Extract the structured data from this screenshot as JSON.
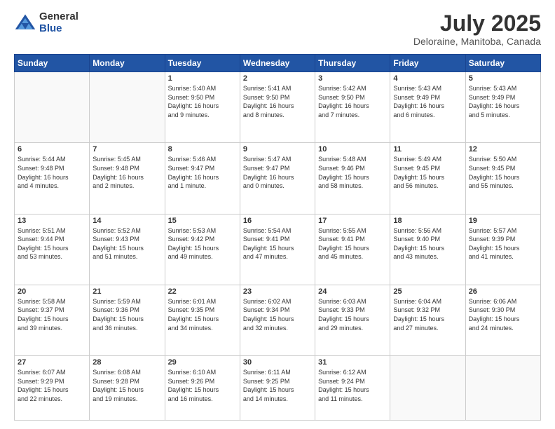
{
  "header": {
    "logo_general": "General",
    "logo_blue": "Blue",
    "month_title": "July 2025",
    "location": "Deloraine, Manitoba, Canada"
  },
  "days_of_week": [
    "Sunday",
    "Monday",
    "Tuesday",
    "Wednesday",
    "Thursday",
    "Friday",
    "Saturday"
  ],
  "weeks": [
    [
      {
        "day": "",
        "info": "",
        "empty": true
      },
      {
        "day": "",
        "info": "",
        "empty": true
      },
      {
        "day": "1",
        "info": "Sunrise: 5:40 AM\nSunset: 9:50 PM\nDaylight: 16 hours\nand 9 minutes."
      },
      {
        "day": "2",
        "info": "Sunrise: 5:41 AM\nSunset: 9:50 PM\nDaylight: 16 hours\nand 8 minutes."
      },
      {
        "day": "3",
        "info": "Sunrise: 5:42 AM\nSunset: 9:50 PM\nDaylight: 16 hours\nand 7 minutes."
      },
      {
        "day": "4",
        "info": "Sunrise: 5:43 AM\nSunset: 9:49 PM\nDaylight: 16 hours\nand 6 minutes."
      },
      {
        "day": "5",
        "info": "Sunrise: 5:43 AM\nSunset: 9:49 PM\nDaylight: 16 hours\nand 5 minutes."
      }
    ],
    [
      {
        "day": "6",
        "info": "Sunrise: 5:44 AM\nSunset: 9:48 PM\nDaylight: 16 hours\nand 4 minutes."
      },
      {
        "day": "7",
        "info": "Sunrise: 5:45 AM\nSunset: 9:48 PM\nDaylight: 16 hours\nand 2 minutes."
      },
      {
        "day": "8",
        "info": "Sunrise: 5:46 AM\nSunset: 9:47 PM\nDaylight: 16 hours\nand 1 minute."
      },
      {
        "day": "9",
        "info": "Sunrise: 5:47 AM\nSunset: 9:47 PM\nDaylight: 16 hours\nand 0 minutes."
      },
      {
        "day": "10",
        "info": "Sunrise: 5:48 AM\nSunset: 9:46 PM\nDaylight: 15 hours\nand 58 minutes."
      },
      {
        "day": "11",
        "info": "Sunrise: 5:49 AM\nSunset: 9:45 PM\nDaylight: 15 hours\nand 56 minutes."
      },
      {
        "day": "12",
        "info": "Sunrise: 5:50 AM\nSunset: 9:45 PM\nDaylight: 15 hours\nand 55 minutes."
      }
    ],
    [
      {
        "day": "13",
        "info": "Sunrise: 5:51 AM\nSunset: 9:44 PM\nDaylight: 15 hours\nand 53 minutes."
      },
      {
        "day": "14",
        "info": "Sunrise: 5:52 AM\nSunset: 9:43 PM\nDaylight: 15 hours\nand 51 minutes."
      },
      {
        "day": "15",
        "info": "Sunrise: 5:53 AM\nSunset: 9:42 PM\nDaylight: 15 hours\nand 49 minutes."
      },
      {
        "day": "16",
        "info": "Sunrise: 5:54 AM\nSunset: 9:41 PM\nDaylight: 15 hours\nand 47 minutes."
      },
      {
        "day": "17",
        "info": "Sunrise: 5:55 AM\nSunset: 9:41 PM\nDaylight: 15 hours\nand 45 minutes."
      },
      {
        "day": "18",
        "info": "Sunrise: 5:56 AM\nSunset: 9:40 PM\nDaylight: 15 hours\nand 43 minutes."
      },
      {
        "day": "19",
        "info": "Sunrise: 5:57 AM\nSunset: 9:39 PM\nDaylight: 15 hours\nand 41 minutes."
      }
    ],
    [
      {
        "day": "20",
        "info": "Sunrise: 5:58 AM\nSunset: 9:37 PM\nDaylight: 15 hours\nand 39 minutes."
      },
      {
        "day": "21",
        "info": "Sunrise: 5:59 AM\nSunset: 9:36 PM\nDaylight: 15 hours\nand 36 minutes."
      },
      {
        "day": "22",
        "info": "Sunrise: 6:01 AM\nSunset: 9:35 PM\nDaylight: 15 hours\nand 34 minutes."
      },
      {
        "day": "23",
        "info": "Sunrise: 6:02 AM\nSunset: 9:34 PM\nDaylight: 15 hours\nand 32 minutes."
      },
      {
        "day": "24",
        "info": "Sunrise: 6:03 AM\nSunset: 9:33 PM\nDaylight: 15 hours\nand 29 minutes."
      },
      {
        "day": "25",
        "info": "Sunrise: 6:04 AM\nSunset: 9:32 PM\nDaylight: 15 hours\nand 27 minutes."
      },
      {
        "day": "26",
        "info": "Sunrise: 6:06 AM\nSunset: 9:30 PM\nDaylight: 15 hours\nand 24 minutes."
      }
    ],
    [
      {
        "day": "27",
        "info": "Sunrise: 6:07 AM\nSunset: 9:29 PM\nDaylight: 15 hours\nand 22 minutes."
      },
      {
        "day": "28",
        "info": "Sunrise: 6:08 AM\nSunset: 9:28 PM\nDaylight: 15 hours\nand 19 minutes."
      },
      {
        "day": "29",
        "info": "Sunrise: 6:10 AM\nSunset: 9:26 PM\nDaylight: 15 hours\nand 16 minutes."
      },
      {
        "day": "30",
        "info": "Sunrise: 6:11 AM\nSunset: 9:25 PM\nDaylight: 15 hours\nand 14 minutes."
      },
      {
        "day": "31",
        "info": "Sunrise: 6:12 AM\nSunset: 9:24 PM\nDaylight: 15 hours\nand 11 minutes."
      },
      {
        "day": "",
        "info": "",
        "empty": true
      },
      {
        "day": "",
        "info": "",
        "empty": true
      }
    ]
  ]
}
